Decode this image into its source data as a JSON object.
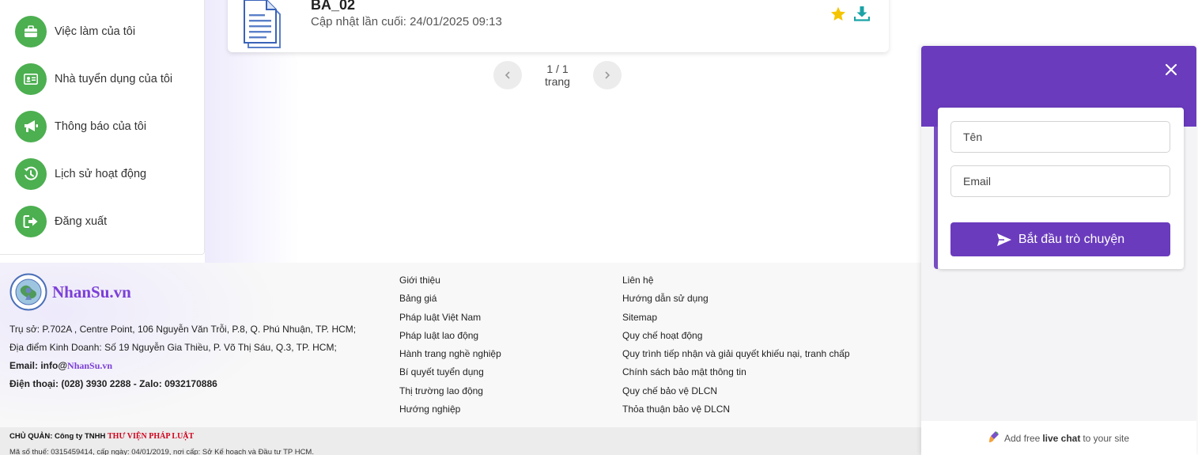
{
  "sidebar": {
    "items": [
      {
        "label": "Việc làm của tôi",
        "icon": "briefcase-icon"
      },
      {
        "label": "Nhà tuyển dụng của tôi",
        "icon": "id-card-icon"
      },
      {
        "label": "Thông báo của tôi",
        "icon": "megaphone-icon"
      },
      {
        "label": "Lịch sử hoạt động",
        "icon": "history-icon"
      },
      {
        "label": "Đăng xuất",
        "icon": "sign-out-icon"
      }
    ]
  },
  "document": {
    "title": "BA_02",
    "updated": "Cập nhật lần cuối: 24/01/2025 09:13"
  },
  "pagination": {
    "text": "1 / 1 trang"
  },
  "footer": {
    "brand": "NhanSu.vn",
    "address": "Trụ sở: P.702A , Centre Point, 106 Nguyễn Văn Trỗi, P.8, Q. Phú Nhuận, TP. HCM;",
    "business": "Địa điểm Kinh Doanh: Số 19 Nguyễn Gia Thiều, P. Võ Thị Sáu, Q.3, TP. HCM;",
    "email_label": "Email: info@",
    "email_brand": "NhanSu.vn",
    "phone": "Điện thoại: (028) 3930 2288 - Zalo: 0932170886",
    "links_col1": [
      "Giới thiệu",
      "Bảng giá",
      "Pháp luật Việt Nam",
      "Pháp luật lao động",
      "Hành trang nghề nghiệp",
      "Bí quyết tuyển dụng",
      "Thị trường lao động",
      "Hướng nghiệp"
    ],
    "links_col2": [
      "Liên hệ",
      "Hướng dẫn sử dụng",
      "Sitemap",
      "Quy chế hoạt động",
      "Quy trình tiếp nhận và giải quyết khiếu nại, tranh chấp",
      "Chính sách bảo mật thông tin",
      "Quy chế bảo vệ DLCN",
      "Thỏa thuận bảo vệ DLCN"
    ],
    "owner_label": "CHỦ QUẢN: Công ty TNHH ",
    "owner_name": "THƯ VIỆN PHÁP LUẬT",
    "tax": "Mã số thuế: 0315459414, cấp ngày: 04/01/2019, nơi cấp: Sở Kế hoạch và Đầu tư TP HCM."
  },
  "chat": {
    "name_placeholder": "Tên",
    "email_placeholder": "Email",
    "start_button": "Bắt đầu trò chuyện",
    "promo_pre": "Add free",
    "promo_bold": "live chat",
    "promo_post": "to your site"
  },
  "colors": {
    "green": "#4caf50",
    "purple": "#6a3bbd",
    "brand_purple": "#7b3fd8",
    "star": "#f5c400",
    "teal": "#1aa3a6"
  }
}
